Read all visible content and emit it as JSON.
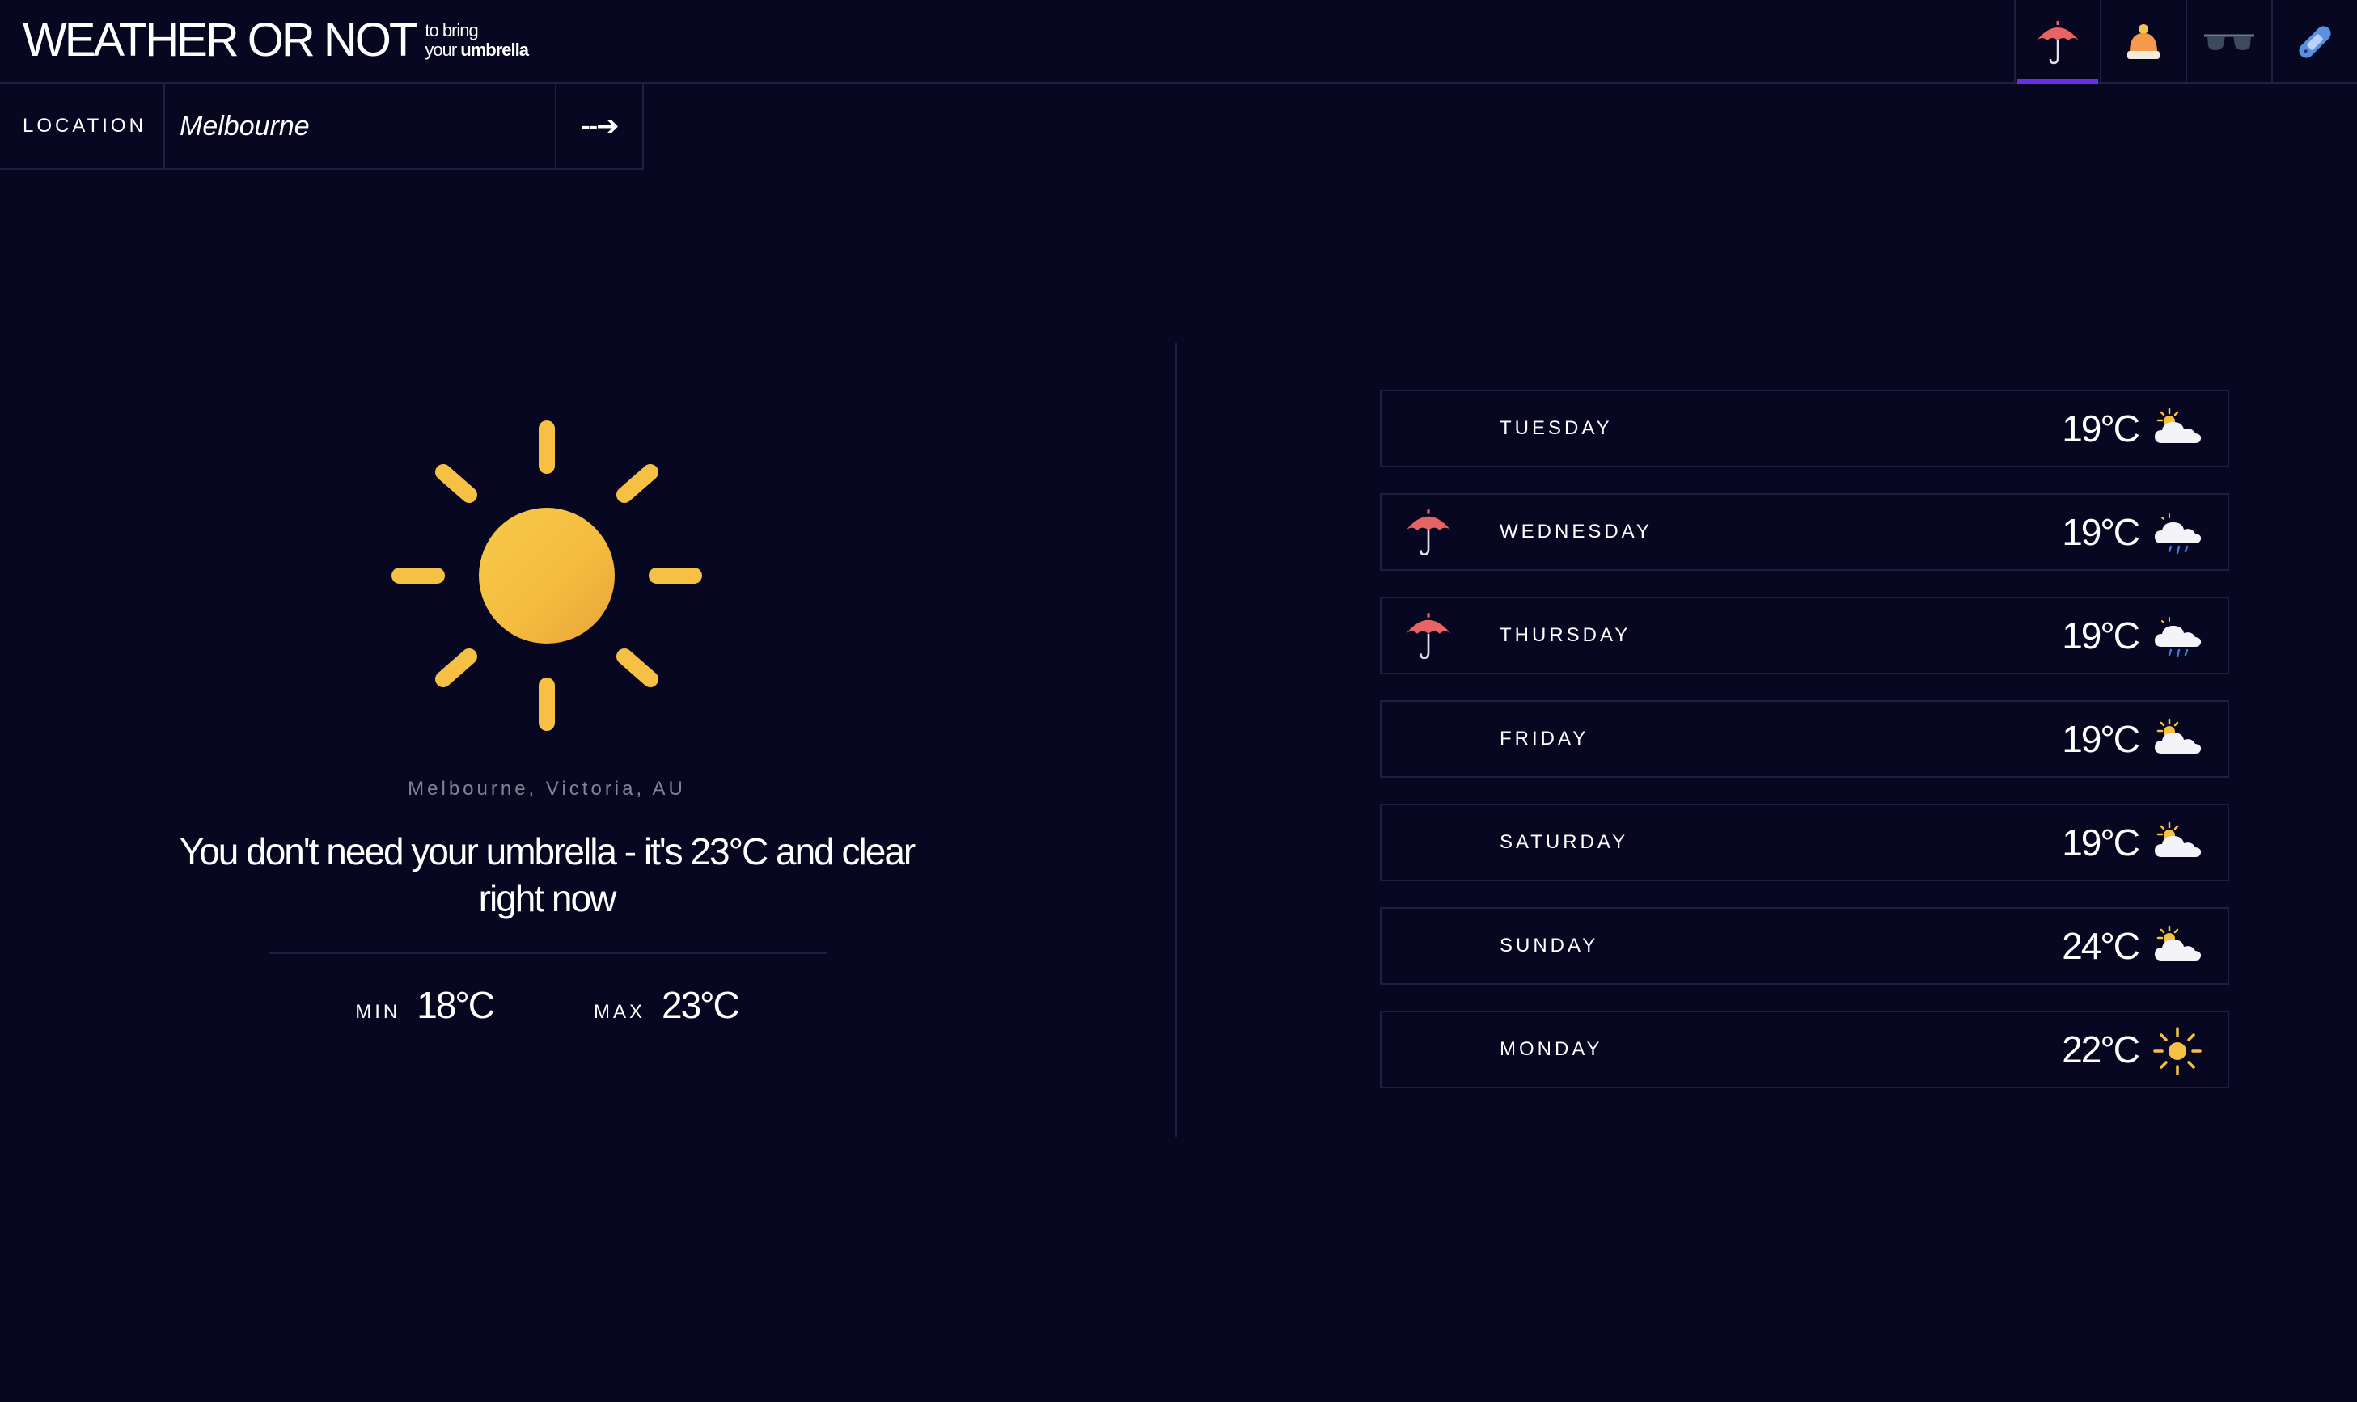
{
  "header": {
    "logo_main": "WEATHER OR NOT",
    "logo_tag_line1": "to bring",
    "logo_tag_prefix": "your",
    "logo_tag_strong": "umbrella",
    "modes": [
      {
        "name": "umbrella-icon",
        "active": true
      },
      {
        "name": "beanie-icon",
        "active": false
      },
      {
        "name": "sunglasses-icon",
        "active": false
      },
      {
        "name": "sunscreen-icon",
        "active": false
      }
    ],
    "accent_color": "#6a2ee8"
  },
  "location": {
    "label": "LOCATION",
    "value": "Melbourne",
    "submit_label": "--➔"
  },
  "current": {
    "icon": "sun-icon",
    "place": "Melbourne, Victoria, AU",
    "summary": "You don't need your umbrella  -  it's 23°C and clear right now",
    "min_label": "MIN",
    "min_value": "18°C",
    "max_label": "MAX",
    "max_value": "23°C"
  },
  "forecast": [
    {
      "day": "TUESDAY",
      "temp": "19°C",
      "icon": "partly-cloudy-icon",
      "umbrella": false
    },
    {
      "day": "WEDNESDAY",
      "temp": "19°C",
      "icon": "rain-cloud-icon",
      "umbrella": true
    },
    {
      "day": "THURSDAY",
      "temp": "19°C",
      "icon": "rain-cloud-icon",
      "umbrella": true
    },
    {
      "day": "FRIDAY",
      "temp": "19°C",
      "icon": "partly-cloudy-icon",
      "umbrella": false
    },
    {
      "day": "SATURDAY",
      "temp": "19°C",
      "icon": "partly-cloudy-icon",
      "umbrella": false
    },
    {
      "day": "SUNDAY",
      "temp": "24°C",
      "icon": "partly-cloudy-icon",
      "umbrella": false
    },
    {
      "day": "MONDAY",
      "temp": "22°C",
      "icon": "sun-icon",
      "umbrella": false
    }
  ],
  "colors": {
    "background": "#070721",
    "border": "#1f2040",
    "sun": "#f5c043",
    "umbrella": "#e86464",
    "muted_text": "#80839a"
  }
}
